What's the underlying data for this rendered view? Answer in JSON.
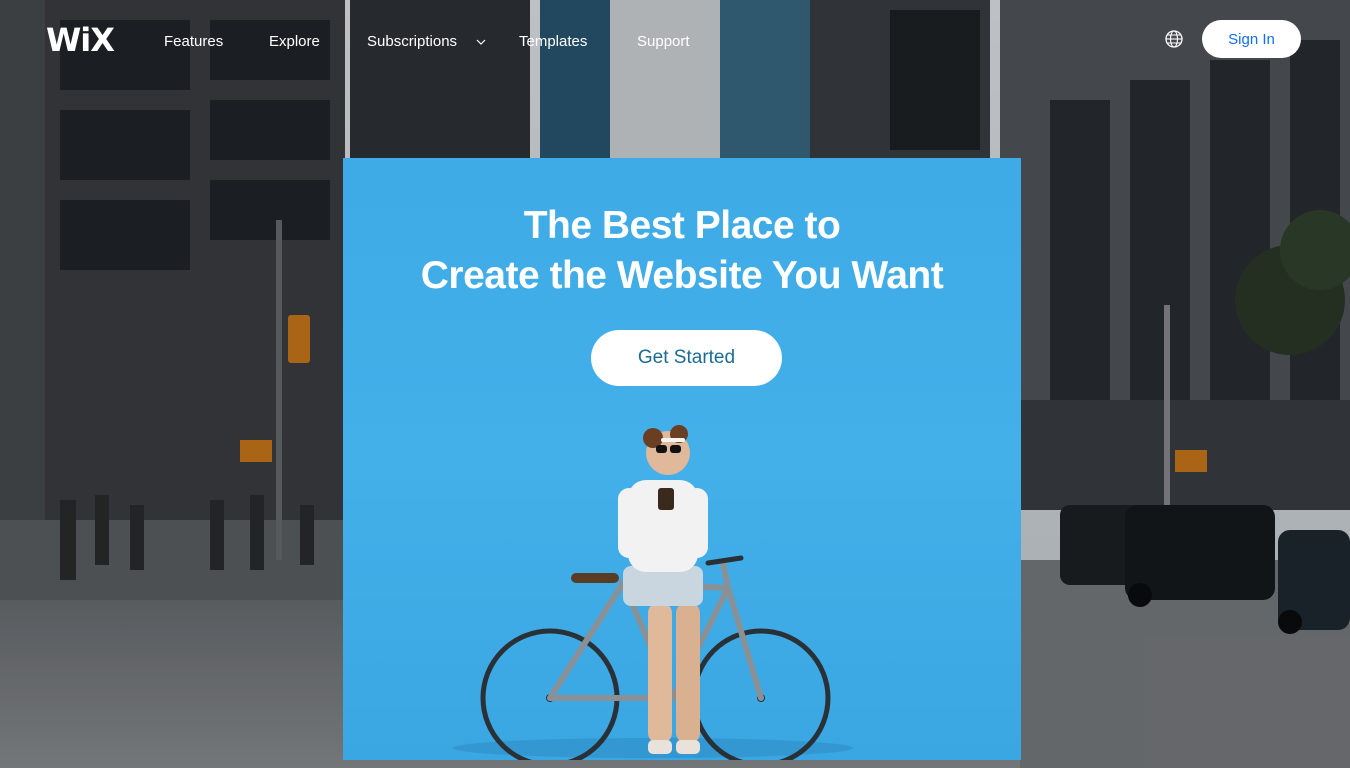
{
  "brand": {
    "logo_text": "WiX"
  },
  "nav": {
    "items": [
      {
        "label": "Features"
      },
      {
        "label": "Explore"
      },
      {
        "label": "Subscriptions",
        "has_dropdown": true
      },
      {
        "label": "Templates"
      },
      {
        "label": "Support"
      }
    ],
    "sign_in_label": "Sign In",
    "language_icon": "globe-icon"
  },
  "hero": {
    "headline_line1": "The Best Place to",
    "headline_line2": "Create the Website You Want",
    "cta_label": "Get Started"
  },
  "colors": {
    "panel_blue": "#3eaae6",
    "sign_in_text": "#116dff",
    "cta_text": "#1b6b95"
  }
}
